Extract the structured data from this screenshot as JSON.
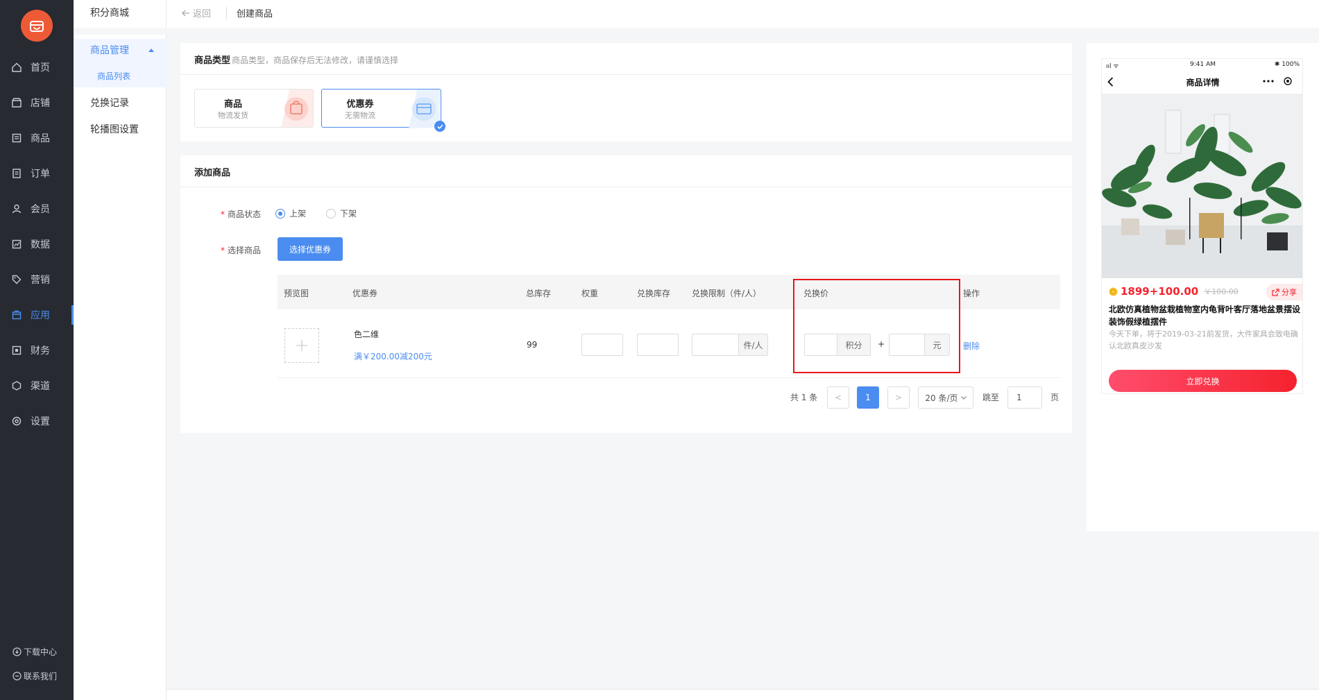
{
  "nav": {
    "items": [
      {
        "label": "首页",
        "icon": "home-icon"
      },
      {
        "label": "店铺",
        "icon": "store-icon"
      },
      {
        "label": "商品",
        "icon": "goods-icon"
      },
      {
        "label": "订单",
        "icon": "order-icon"
      },
      {
        "label": "会员",
        "icon": "member-icon"
      },
      {
        "label": "数据",
        "icon": "chart-icon"
      },
      {
        "label": "营销",
        "icon": "tag-icon"
      },
      {
        "label": "应用",
        "icon": "app-icon",
        "active": true
      },
      {
        "label": "财务",
        "icon": "finance-icon"
      },
      {
        "label": "渠道",
        "icon": "channel-icon"
      },
      {
        "label": "设置",
        "icon": "gear-icon"
      }
    ],
    "footer": {
      "download": "下载中心",
      "contact": "联系我们"
    }
  },
  "subnav": {
    "title": "积分商城",
    "group": "商品管理",
    "group_child": "商品列表",
    "items": [
      "兑换记录",
      "轮播图设置"
    ]
  },
  "header": {
    "back": "返回",
    "title": "创建商品"
  },
  "type_section": {
    "title": "商品类型",
    "hint": "商品类型，商品保存后无法修改，请谨慎选择",
    "options": [
      {
        "name": "商品",
        "desc": "物流发货",
        "selected": false
      },
      {
        "name": "优惠券",
        "desc": "无需物流",
        "selected": true
      }
    ]
  },
  "add_section": {
    "title": "添加商品",
    "status_label": "商品状态",
    "status_on": "上架",
    "status_off": "下架",
    "status_value": "上架",
    "select_label": "选择商品",
    "select_button": "选择优惠券"
  },
  "table": {
    "headers": [
      "预览图",
      "优惠券",
      "总库存",
      "权重",
      "兑换库存",
      "兑换限制（件/人）",
      "兑换价",
      "操作"
    ],
    "rows": [
      {
        "coupon_name": "色二维",
        "coupon_rule": "满￥200.00减200元",
        "total_stock": "99",
        "limit_unit": "件/人",
        "points_unit": "积分",
        "plus": "+",
        "yuan_unit": "元",
        "action": "删除"
      }
    ]
  },
  "pagination": {
    "total": "共 1 条",
    "prev": "<",
    "current": "1",
    "next": ">",
    "page_size": "20 条/页",
    "jump_label": "跳至",
    "jump_value": "1",
    "page_suffix": "页"
  },
  "preview": {
    "status_left": "ııl ᯤ",
    "time": "9:41 AM",
    "battery": "✱ 100%",
    "title": "商品详情",
    "price": "1899+100.00",
    "old_price": "￥100.00",
    "share": "分享",
    "product_title": "北欧仿真植物盆栽植物室内龟背叶客厅落地盆景摆设装饰假绿植摆件",
    "product_desc": "今天下单，将于2019-03-21前发货，大件家具会致电确认北欧真皮沙发",
    "redeem_button": "立即兑换"
  },
  "colors": {
    "primary": "#4a8cf0",
    "sidebar": "#272a31",
    "highlight": "#e8151b",
    "price": "#f5222d"
  }
}
